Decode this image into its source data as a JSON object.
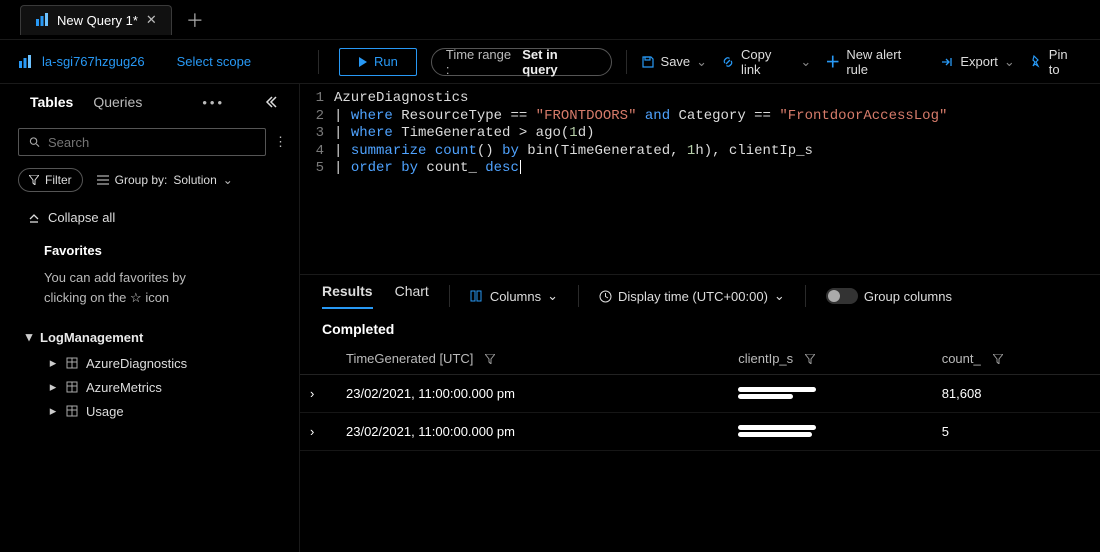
{
  "tab": {
    "title": "New Query 1*"
  },
  "scope": {
    "workspace": "la-sgi767hzgug26",
    "select_scope": "Select scope"
  },
  "toolbar": {
    "run": "Run",
    "time_label": "Time range :",
    "time_value": "Set in query",
    "save": "Save",
    "copy_link": "Copy link",
    "new_alert_rule": "New alert rule",
    "export": "Export",
    "pin_to": "Pin to"
  },
  "sidebar": {
    "tabs": {
      "tables": "Tables",
      "queries": "Queries"
    },
    "search_placeholder": "Search",
    "filter": "Filter",
    "groupby_label": "Group by:",
    "groupby_value": "Solution",
    "collapse_all": "Collapse all",
    "favorites_header": "Favorites",
    "favorites_note_a": "You can add favorites by clicking on",
    "favorites_note_b": "the",
    "favorites_note_c": "icon",
    "groups": {
      "logmgmt": {
        "label": "LogManagement",
        "items": [
          "AzureDiagnostics",
          "AzureMetrics",
          "Usage"
        ]
      }
    }
  },
  "query": {
    "lines": [
      "AzureDiagnostics",
      "| where ResourceType == \"FRONTDOORS\" and Category == \"FrontdoorAccessLog\"",
      "| where TimeGenerated > ago(1d)",
      "| summarize count() by bin(TimeGenerated, 1h), clientIp_s",
      "| order by count_ desc"
    ]
  },
  "results": {
    "tabs": {
      "results": "Results",
      "chart": "Chart"
    },
    "columns_btn": "Columns",
    "display_time": "Display time (UTC+00:00)",
    "group_columns": "Group columns",
    "status": "Completed",
    "headers": [
      "TimeGenerated [UTC]",
      "clientIp_s",
      "count_"
    ],
    "rows": [
      {
        "time": "23/02/2021, 11:00:00.000 pm",
        "count": "81,608"
      },
      {
        "time": "23/02/2021, 11:00:00.000 pm",
        "count": "5"
      }
    ]
  }
}
